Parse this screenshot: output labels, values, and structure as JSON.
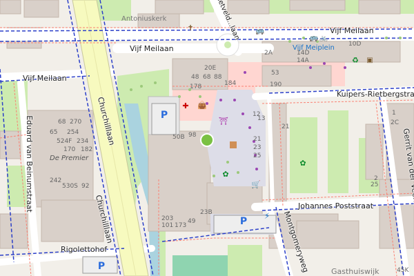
{
  "streets": {
    "vijf_meilaan_top": "Vijf Meilaan",
    "vijf_meilaan_mid": "Vijf Meilaan",
    "vijf_meilaan_left": "Vijf Meilaan",
    "churchilllaan_1": "Churchilllaan",
    "churchilllaan_2": "Churchilllaan",
    "eduard": "Eduard van Beinumstraat",
    "kuipers": "Kuipers-Rietbergstraat",
    "johannes": "Johannes Poststraat",
    "montgomery": "Montgomeryweg",
    "gerrit": "Gerrit van der Veenstraat",
    "rigoletto": "Rigolettohof",
    "rietveld": "Rietveld...laan"
  },
  "places": {
    "antoniuskerk": "Antoniuskerk",
    "de_premier": "De Premier",
    "vijf_meiplein": "Vijf Meiplein",
    "gasthuiswijk": "Gasthuiswijk"
  },
  "house_numbers": {
    "n68": "68",
    "n270": "270",
    "n65": "65",
    "n254": "254",
    "n524F": "524F",
    "n234": "234",
    "n170": "170",
    "n182": "182",
    "n242": "242",
    "n530S": "530S",
    "n92": "92",
    "n20E": "20E",
    "n48": "48",
    "n68b": "68",
    "n88": "88",
    "n178": "178",
    "n190": "190",
    "n184": "184",
    "n12": "12",
    "n50B": "50B",
    "n98": "98",
    "n21": "21",
    "n23": "23",
    "n25": "25",
    "n23B": "23B",
    "n203": "203",
    "n101": "101",
    "n173": "173",
    "n49": "49",
    "n2A": "2A",
    "n14D": "14D",
    "n14A": "14A",
    "n10D": "10D",
    "n53": "53",
    "n2": "2",
    "n25b": "25",
    "n45K": "45K",
    "n1": "1",
    "n2C": "2C",
    "n21b": "21",
    "n13": "13"
  },
  "icons": [
    "church-icon",
    "bus-stop-icon",
    "bicycle-parking-icon",
    "parking-icon",
    "pharmacy-icon",
    "shop-icon",
    "playground-icon",
    "fountain-icon",
    "recycling-icon",
    "ev-charging-icon",
    "tree-icon"
  ],
  "colors": {
    "background": "#f2efe9",
    "building": "#d9d0c9",
    "park": "#cdebb0",
    "water": "#aad3df",
    "road_primary": "#f7fabf",
    "road_white": "#ffffff",
    "pedestrian": "#dddde8",
    "retail": "#ffd6d1",
    "parking_blue": "#2a6cdc"
  }
}
